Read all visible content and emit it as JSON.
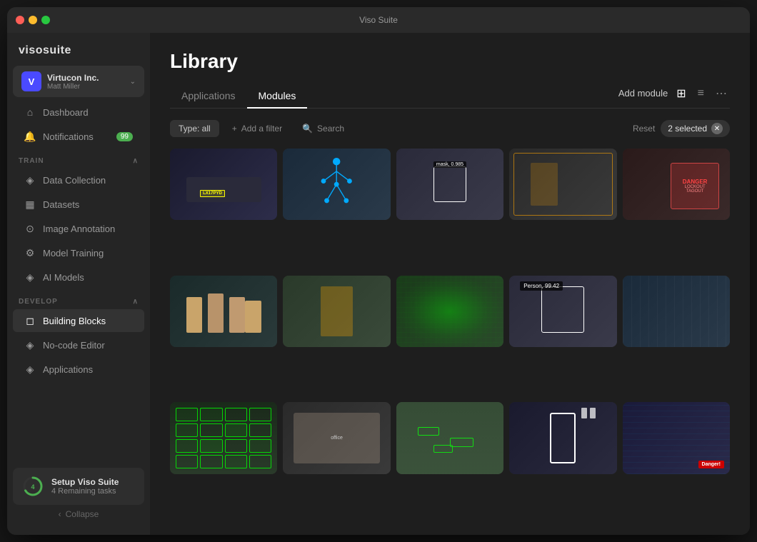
{
  "window": {
    "title": "Viso Suite"
  },
  "sidebar": {
    "logo": "visosuite",
    "account": {
      "initial": "V",
      "company": "Virtucon Inc.",
      "user": "Matt Miller",
      "chevron": "›"
    },
    "nav": [
      {
        "id": "dashboard",
        "label": "Dashboard",
        "icon": "⌂",
        "badge": null
      },
      {
        "id": "notifications",
        "label": "Notifications",
        "icon": "🔔",
        "badge": "99"
      }
    ],
    "sections": [
      {
        "id": "train",
        "label": "TRAIN",
        "items": [
          {
            "id": "data-collection",
            "label": "Data Collection",
            "icon": "◈"
          },
          {
            "id": "datasets",
            "label": "Datasets",
            "icon": "▦"
          },
          {
            "id": "image-annotation",
            "label": "Image Annotation",
            "icon": "⊙"
          },
          {
            "id": "model-training",
            "label": "Model Training",
            "icon": "⚙"
          },
          {
            "id": "ai-models",
            "label": "AI Models",
            "icon": "◈"
          }
        ]
      },
      {
        "id": "develop",
        "label": "DEVELOP",
        "items": [
          {
            "id": "building-blocks",
            "label": "Building Blocks",
            "icon": "◻",
            "active": true
          },
          {
            "id": "no-code-editor",
            "label": "No-code Editor",
            "icon": "◈"
          },
          {
            "id": "applications",
            "label": "Applications",
            "icon": "◈"
          }
        ]
      }
    ],
    "setup": {
      "title": "Setup Viso Suite",
      "subtitle": "4 Remaining tasks",
      "progress": 4,
      "color": "#4caf50"
    },
    "collapse_label": "Collapse"
  },
  "main": {
    "title": "Library",
    "tabs": [
      {
        "id": "applications",
        "label": "Applications",
        "active": false
      },
      {
        "id": "modules",
        "label": "Modules",
        "active": true
      }
    ],
    "toolbar": {
      "add_module": "Add module",
      "view_grid_icon": "⊞",
      "view_list_icon": "≡",
      "view_more_icon": "⋯"
    },
    "filters": {
      "type_label": "Type: all",
      "add_filter": "+ Add a filter",
      "search": "Search",
      "reset": "Reset",
      "selected_count": "2 selected"
    },
    "grid": {
      "items": [
        {
          "id": 1,
          "type": "car-detection",
          "theme": "t1"
        },
        {
          "id": 2,
          "type": "pose-estimation",
          "theme": "t2"
        },
        {
          "id": 3,
          "type": "face-mask",
          "theme": "t3"
        },
        {
          "id": 4,
          "type": "safety-vest",
          "theme": "t4"
        },
        {
          "id": 5,
          "type": "danger-sign",
          "theme": "t5"
        },
        {
          "id": 6,
          "type": "people-group",
          "theme": "t6"
        },
        {
          "id": 7,
          "type": "worker-back",
          "theme": "t7"
        },
        {
          "id": 8,
          "type": "globe-heatmap",
          "theme": "t8"
        },
        {
          "id": 9,
          "type": "person-detection",
          "theme": "t9"
        },
        {
          "id": 10,
          "type": "warehouse",
          "theme": "t10"
        },
        {
          "id": 11,
          "type": "parking-lot",
          "theme": "t11"
        },
        {
          "id": 12,
          "type": "office-meeting",
          "theme": "t12"
        },
        {
          "id": 13,
          "type": "road-vehicles",
          "theme": "t13"
        },
        {
          "id": 14,
          "type": "pedestrian-crossing",
          "theme": "t14"
        },
        {
          "id": 15,
          "type": "railway",
          "theme": "t15"
        }
      ]
    }
  }
}
